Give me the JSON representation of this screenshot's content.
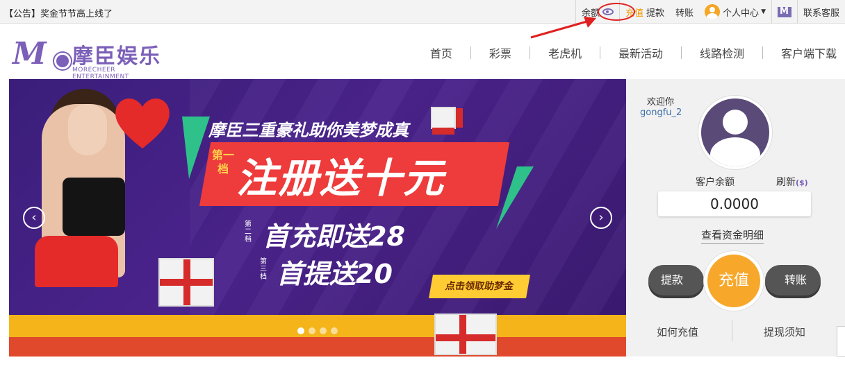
{
  "topbar": {
    "notice": "【公告】奖金节节高上线了",
    "balance_label": "余额",
    "recharge_label": "充值",
    "withdraw_label": "提款",
    "transfer_label": "转账",
    "user_center_label": "个人中心",
    "support_label": "联系客服"
  },
  "logo": {
    "mark": "MC",
    "name_cn": "摩臣娱乐",
    "name_en": "MORECHEER ENTERTAINMENT"
  },
  "nav": {
    "items": [
      "首页",
      "彩票",
      "老虎机",
      "最新活动",
      "线路检测",
      "客户端下载"
    ]
  },
  "banner": {
    "headline": "摩臣三重豪礼助你美梦成真",
    "level1_label": "第一档",
    "main_offer": "注册送十元",
    "level2_label": "第二档",
    "offer2": "首充即送28",
    "level3_label": "第三档",
    "offer3": "首提送20",
    "cta": "点击领取助梦金",
    "prev_icon": "‹",
    "next_icon": "›",
    "slide_count": 4,
    "active_slide": 0
  },
  "panel": {
    "welcome": "欢迎你",
    "username": "gongfu_2",
    "balance_label": "客户余额",
    "refresh_label": "刷新",
    "refresh_icon": "($)",
    "balance_value": "0.0000",
    "detail_link": "查看资金明细",
    "withdraw_btn": "提款",
    "recharge_btn": "充值",
    "transfer_btn": "转账",
    "how_to_recharge": "如何充值",
    "withdraw_notice": "提现须知"
  },
  "colors": {
    "brand_purple": "#7b5fb8",
    "accent_orange": "#f7a82b",
    "highlight_red": "#e02020"
  }
}
